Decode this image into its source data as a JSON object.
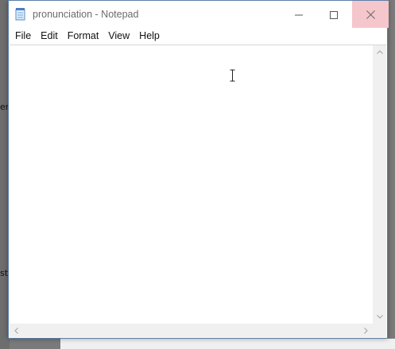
{
  "window": {
    "title": "pronunciation - Notepad",
    "app_icon": "notepad-icon"
  },
  "controls": {
    "minimize_icon": "minimize-icon",
    "maximize_icon": "maximize-icon",
    "close_icon": "close-icon"
  },
  "menu": {
    "items": [
      {
        "label": "File"
      },
      {
        "label": "Edit"
      },
      {
        "label": "Format"
      },
      {
        "label": "View"
      },
      {
        "label": "Help"
      }
    ]
  },
  "editor": {
    "content": ""
  },
  "background": {
    "left_text_1": "er",
    "left_text_2": "st"
  },
  "colors": {
    "close_hover": "#f5c6cb",
    "scrollbar": "#f0f0f0",
    "window_border": "#5b7fa8"
  }
}
